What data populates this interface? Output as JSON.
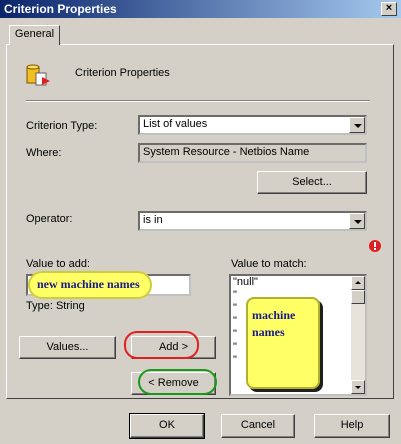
{
  "window": {
    "title": "Criterion Properties",
    "close_glyph": "×"
  },
  "tabs": [
    {
      "label": "General"
    }
  ],
  "header": {
    "title": "Criterion Properties",
    "icon": "criterion-properties-icon"
  },
  "form": {
    "criterion_type_label": "Criterion Type:",
    "criterion_type_value": "List of values",
    "where_label": "Where:",
    "where_value": "System Resource - Netbios Name",
    "select_button": "Select...",
    "operator_label": "Operator:",
    "operator_value": "is in",
    "value_to_add_label": "Value to add:",
    "value_to_add_value": "",
    "type_label": "Type: String",
    "value_to_match_label": "Value to match:",
    "value_to_match_items": [
      "\"null\"",
      "\"",
      "\"",
      "\"",
      "\"",
      "\"",
      "\""
    ],
    "values_button": "Values...",
    "add_button": "Add >",
    "remove_button": "< Remove"
  },
  "annotations": {
    "new_machine_names": "new machine names",
    "machine_names": "machine names"
  },
  "footer": {
    "ok": "OK",
    "cancel": "Cancel",
    "help": "Help"
  },
  "colors": {
    "callout": "#ffff66",
    "add_circle": "#e02020",
    "remove_circle": "#1a9a1a",
    "warning": "#e02020"
  }
}
